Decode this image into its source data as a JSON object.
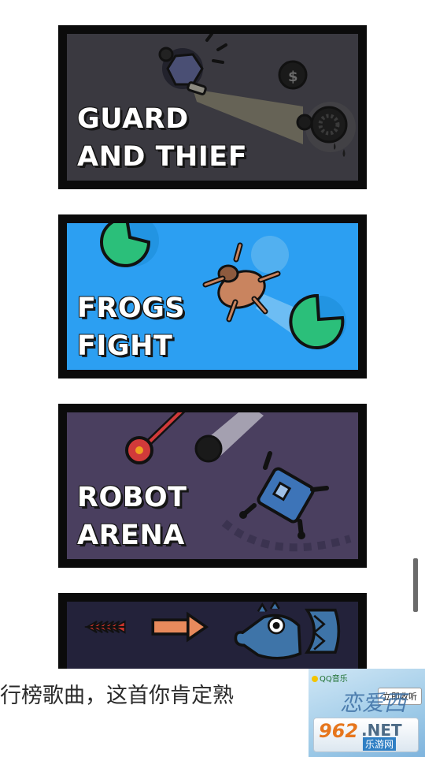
{
  "games": [
    {
      "id": "guard-and-thief",
      "title_lines": [
        "GUARD",
        "AND THIEF"
      ]
    },
    {
      "id": "frogs-fight",
      "title_lines": [
        "FROGS",
        "FIGHT"
      ]
    },
    {
      "id": "robot-arena",
      "title_lines": [
        "ROBOT",
        "ARENA"
      ]
    },
    {
      "id": "dragon",
      "title_lines": []
    }
  ],
  "banner": {
    "text": "行榜歌曲，这首你肯定熟",
    "ad": {
      "music_logo": "QQ音乐",
      "listen_button": "立即收听",
      "song_art": "恋爱西",
      "site_number": "962",
      "site_net": ".NET",
      "site_name": "乐游网"
    }
  },
  "colors": {
    "guard_bg": "#3a3940",
    "frogs_bg": "#2c9ff2",
    "robot_bg": "#4a3f5f",
    "dragon_bg": "#23223a",
    "frame": "#0b0b0b"
  }
}
